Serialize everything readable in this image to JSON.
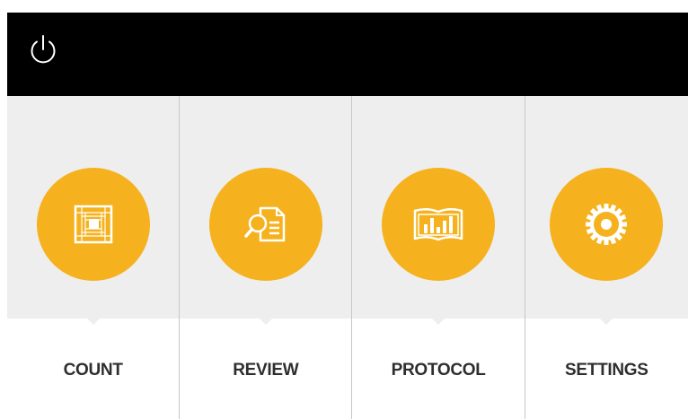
{
  "app": {
    "colors": {
      "topbar": "#000000",
      "tile_background": "#eeeeee",
      "accent": "#f5b21e",
      "label_text": "#2e2e2e"
    }
  },
  "topbar": {
    "power_icon": "power-icon"
  },
  "menu": {
    "items": [
      {
        "label": "COUNT",
        "icon": "hemocytometer-grid-icon"
      },
      {
        "label": "REVIEW",
        "icon": "document-magnifier-icon"
      },
      {
        "label": "PROTOCOL",
        "icon": "book-chart-icon"
      },
      {
        "label": "SETTINGS",
        "icon": "gear-icon"
      }
    ]
  }
}
